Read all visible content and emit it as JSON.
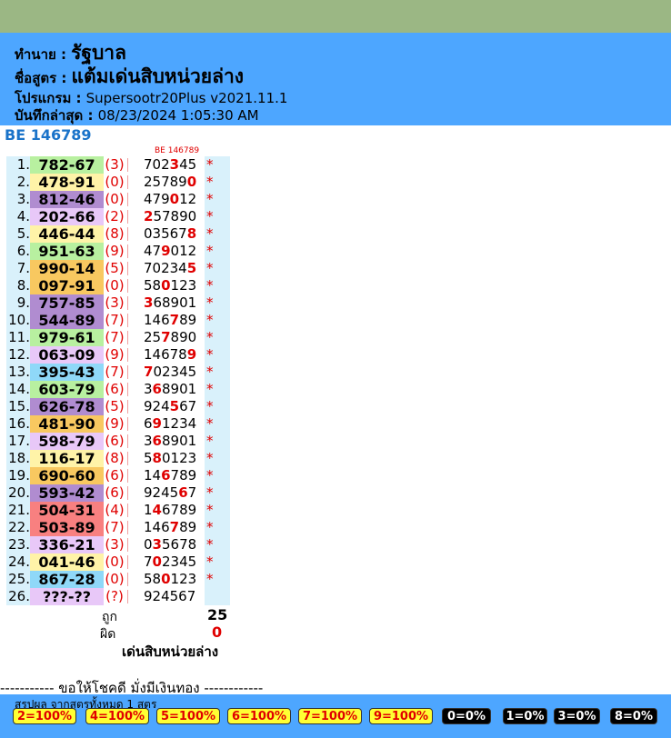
{
  "header": {
    "forecast_label": "ทำนาย :",
    "forecast_value": "รัฐบาล",
    "formula_label": "ชื่อสูตร :",
    "formula_value": "แต้มเด่นสิบหน่วยล่าง",
    "program_label": "โปรแกรม :",
    "program_value": "Supersootr20Plus v2021.11.1",
    "saved_label": "บันทึกล่าสุด :",
    "saved_value": "08/23/2024 1:05:30 AM"
  },
  "title": "BE 146789",
  "column_header": "BE 146789",
  "rows": [
    {
      "n": "1.",
      "code": "782-67",
      "p": "(3)",
      "a": "702",
      "h": "3",
      "b": "45",
      "star": "*",
      "color": "#b8f0a0"
    },
    {
      "n": "2.",
      "code": "478-91",
      "p": "(0)",
      "a": "25789",
      "h": "0",
      "b": "",
      "star": "*",
      "color": "#fff3a8"
    },
    {
      "n": "3.",
      "code": "812-46",
      "p": "(0)",
      "a": "479",
      "h": "0",
      "b": "12",
      "star": "*",
      "color": "#b08cd0"
    },
    {
      "n": "4.",
      "code": "202-66",
      "p": "(2)",
      "a": "",
      "h": "2",
      "b": "57890",
      "star": "*",
      "color": "#e8c8f8"
    },
    {
      "n": "5.",
      "code": "446-44",
      "p": "(8)",
      "a": "03567",
      "h": "8",
      "b": "",
      "star": "*",
      "color": "#fff3a8"
    },
    {
      "n": "6.",
      "code": "951-63",
      "p": "(9)",
      "a": "47",
      "h": "9",
      "b": "012",
      "star": "*",
      "color": "#b8f0a0"
    },
    {
      "n": "7.",
      "code": "990-14",
      "p": "(5)",
      "a": "70234",
      "h": "5",
      "b": "",
      "star": "*",
      "color": "#f8c860"
    },
    {
      "n": "8.",
      "code": "097-91",
      "p": "(0)",
      "a": "58",
      "h": "0",
      "b": "123",
      "star": "*",
      "color": "#f8c860"
    },
    {
      "n": "9.",
      "code": "757-85",
      "p": "(3)",
      "a": "",
      "h": "3",
      "b": "68901",
      "star": "*",
      "color": "#b08cd0"
    },
    {
      "n": "10.",
      "code": "544-89",
      "p": "(7)",
      "a": "146",
      "h": "7",
      "b": "89",
      "star": "*",
      "color": "#b08cd0"
    },
    {
      "n": "11.",
      "code": "979-61",
      "p": "(7)",
      "a": "25",
      "h": "7",
      "b": "890",
      "star": "*",
      "color": "#b8f0a0"
    },
    {
      "n": "12.",
      "code": "063-09",
      "p": "(9)",
      "a": "14678",
      "h": "9",
      "b": "",
      "star": "*",
      "color": "#e8c8f8"
    },
    {
      "n": "13.",
      "code": "395-43",
      "p": "(7)",
      "a": "",
      "h": "7",
      "b": "02345",
      "star": "*",
      "color": "#8fd8f8"
    },
    {
      "n": "14.",
      "code": "603-79",
      "p": "(6)",
      "a": "3",
      "h": "6",
      "b": "8901",
      "star": "*",
      "color": "#b8f0a0"
    },
    {
      "n": "15.",
      "code": "626-78",
      "p": "(5)",
      "a": "924",
      "h": "5",
      "b": "67",
      "star": "*",
      "color": "#b08cd0"
    },
    {
      "n": "16.",
      "code": "481-90",
      "p": "(9)",
      "a": "6",
      "h": "9",
      "b": "1234",
      "star": "*",
      "color": "#f8c860"
    },
    {
      "n": "17.",
      "code": "598-79",
      "p": "(6)",
      "a": "3",
      "h": "6",
      "b": "8901",
      "star": "*",
      "color": "#e8c8f8"
    },
    {
      "n": "18.",
      "code": "116-17",
      "p": "(8)",
      "a": "5",
      "h": "8",
      "b": "0123",
      "star": "*",
      "color": "#fff3a8"
    },
    {
      "n": "19.",
      "code": "690-60",
      "p": "(6)",
      "a": "14",
      "h": "6",
      "b": "789",
      "star": "*",
      "color": "#f8c860"
    },
    {
      "n": "20.",
      "code": "593-42",
      "p": "(6)",
      "a": "9245",
      "h": "6",
      "b": "7",
      "star": "*",
      "color": "#b08cd0"
    },
    {
      "n": "21.",
      "code": "504-31",
      "p": "(4)",
      "a": "1",
      "h": "4",
      "b": "6789",
      "star": "*",
      "color": "#f88080"
    },
    {
      "n": "22.",
      "code": "503-89",
      "p": "(7)",
      "a": "146",
      "h": "7",
      "b": "89",
      "star": "*",
      "color": "#f88080"
    },
    {
      "n": "23.",
      "code": "336-21",
      "p": "(3)",
      "a": "0",
      "h": "3",
      "b": "5678",
      "star": "*",
      "color": "#e8c8f8"
    },
    {
      "n": "24.",
      "code": "041-46",
      "p": "(0)",
      "a": "7",
      "h": "0",
      "b": "2345",
      "star": "*",
      "color": "#fff3a8"
    },
    {
      "n": "25.",
      "code": "867-28",
      "p": "(0)",
      "a": "58",
      "h": "0",
      "b": "123",
      "star": "*",
      "color": "#8fd8f8"
    },
    {
      "n": "26.",
      "code": "???-??",
      "p": "(?)",
      "a": "924567",
      "h": "",
      "b": "",
      "star": "",
      "color": "#e8c8f8"
    }
  ],
  "summary": {
    "correct_label": "ถูก",
    "correct_value": "25",
    "wrong_label": "ผิด",
    "wrong_value": "0",
    "formula_name": "เด่นสิบหน่วยล่าง"
  },
  "footer": {
    "blessing": "----------- ขอให้โชคดี มั่งมีเงินทอง ------------",
    "summary_title": "สรุปผล จากสูตรทั้งหมด 1 สูตร"
  },
  "badges": [
    {
      "label": "2=100%",
      "style": "y"
    },
    {
      "label": "4=100%",
      "style": "y"
    },
    {
      "label": "5=100%",
      "style": "y"
    },
    {
      "label": "6=100%",
      "style": "y"
    },
    {
      "label": "7=100%",
      "style": "y"
    },
    {
      "label": "9=100%",
      "style": "y"
    },
    {
      "label": "0=0%",
      "style": "k"
    },
    {
      "label": "1=0%",
      "style": "k"
    },
    {
      "label": "3=0%",
      "style": "k"
    },
    {
      "label": "8=0%",
      "style": "k"
    }
  ]
}
